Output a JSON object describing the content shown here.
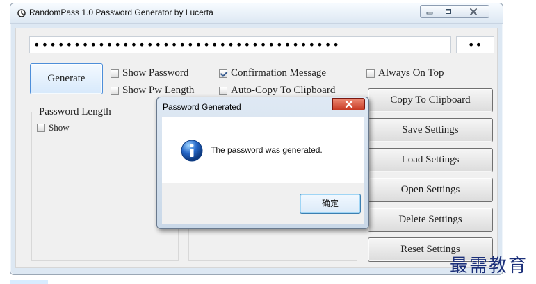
{
  "app": {
    "title": "RandomPass 1.0 Password Generator by Lucerta",
    "icon": "clock-icon"
  },
  "window_controls": {
    "minimize_icon": "minimize-icon",
    "restore_icon": "restore-icon",
    "close_icon": "close-icon"
  },
  "password": {
    "value": "••••••••••••••••••••••••••••••••••••••",
    "length_preview": "••"
  },
  "buttons": {
    "generate": "Generate",
    "copy": "Copy To Clipboard",
    "save": "Save Settings",
    "load": "Load Settings",
    "open": "Open Settings",
    "delete": "Delete Settings",
    "reset": "Reset Settings"
  },
  "options": [
    {
      "label": "Show Password",
      "checked": false
    },
    {
      "label": "Confirmation Message",
      "checked": true
    },
    {
      "label": "Always On Top",
      "checked": false
    },
    {
      "label": "Show Pw Length",
      "checked": false
    },
    {
      "label": "Auto-Copy To Clipboard",
      "checked": false
    }
  ],
  "password_length": {
    "title": "Password Length",
    "show_label": "Show",
    "show_checked": false
  },
  "dialog": {
    "title": "Password Generated",
    "message": "The password was generated.",
    "ok_label": "确定",
    "icon": "info-icon"
  },
  "watermark": {
    "text": "最需教育"
  },
  "colors": {
    "window_bg": "#dde8f3",
    "client_bg": "#f0f0f0",
    "accent_blue": "#4d8ed9",
    "close_red": "#c73a24",
    "watermark": "#1b2f79"
  }
}
